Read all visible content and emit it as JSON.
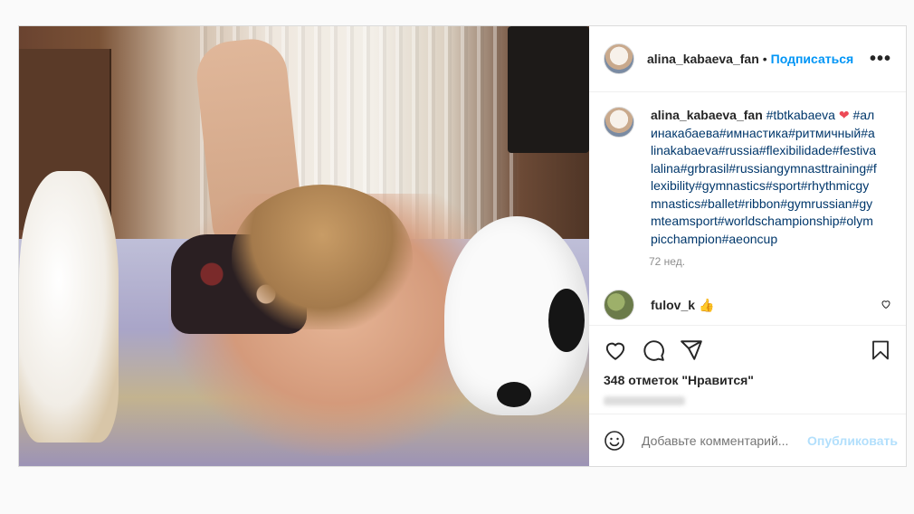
{
  "post": {
    "username": "alina_kabaeva_fan",
    "separator": "•",
    "follow_label": "Подписаться",
    "more_label": "•••"
  },
  "caption": {
    "username": "alina_kabaeva_fan",
    "first_tag": "#tbtkabaeva",
    "emoji": "❤",
    "tags_text": "#алинакабаева#имнастика#ритмичный#alinakabaeva#russia#flexibilidade#festivalalina#grbrasil#russiangymnasttraining#flexibility#gymnastics#sport#rhythmicgymnastics#ballet#ribbon#gymrussian#gymteamsport#worldschampionship#olympicchampion#aeoncup",
    "time": "72 нед."
  },
  "comment": {
    "username": "fulov_k",
    "emoji": "👍"
  },
  "icons": {
    "like": "heart-icon",
    "comment": "comment-icon",
    "share": "share-icon",
    "save": "bookmark-icon",
    "emoji": "smiley-icon"
  },
  "likes_text": "348 отметок \"Нравится\"",
  "add_comment": {
    "placeholder": "Добавьте комментарий...",
    "publish_label": "Опубликовать"
  },
  "colors": {
    "link": "#0095f6",
    "hashtag": "#00376b",
    "publish_disabled": "#b2dffc"
  }
}
